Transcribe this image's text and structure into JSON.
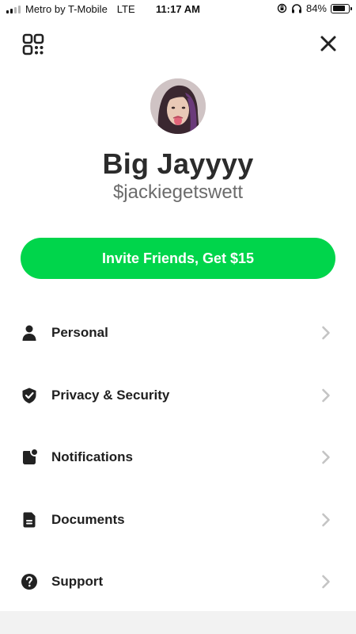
{
  "status_bar": {
    "carrier": "Metro by T-Mobile",
    "network": "LTE",
    "time": "11:17 AM",
    "battery": "84%",
    "battery_level": 0.84
  },
  "profile": {
    "name": "Big Jayyyy",
    "cashtag": "$jackiegetswett"
  },
  "invite_button_label": "Invite Friends, Get $15",
  "menu": {
    "items": [
      {
        "label": "Personal",
        "icon": "person-icon"
      },
      {
        "label": "Privacy & Security",
        "icon": "shield-check-icon"
      },
      {
        "label": "Notifications",
        "icon": "notification-badge-icon"
      },
      {
        "label": "Documents",
        "icon": "document-icon"
      },
      {
        "label": "Support",
        "icon": "question-circle-icon"
      }
    ]
  },
  "colors": {
    "accent_green": "#00d54b",
    "text_dark": "#1f1f1f",
    "text_muted": "#6b6b6b",
    "chevron": "#c4c4c4"
  }
}
